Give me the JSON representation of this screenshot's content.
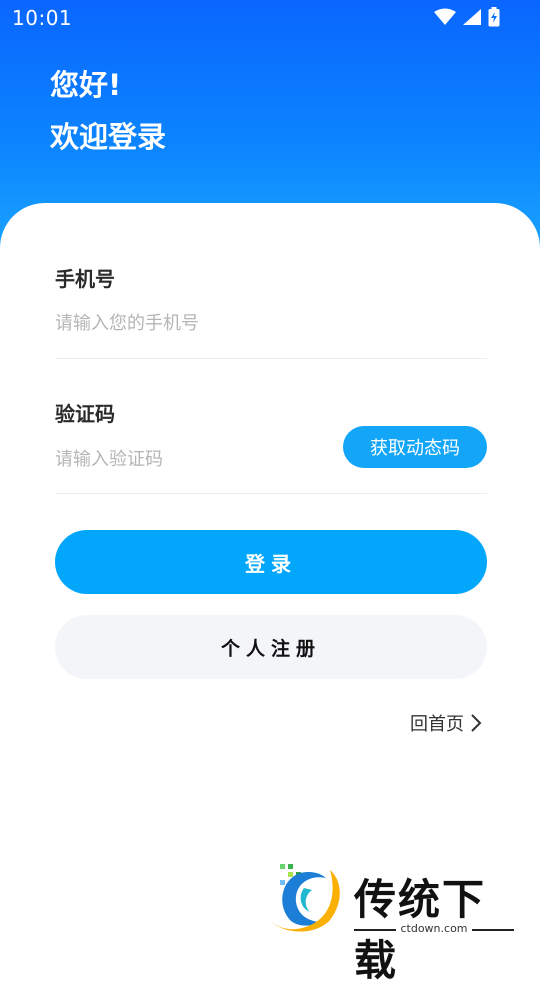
{
  "status_bar": {
    "time": "10:01",
    "icons": [
      "wifi-icon",
      "signal-icon",
      "battery-charging-icon"
    ]
  },
  "header": {
    "greeting_line1": "您好!",
    "greeting_line2": "欢迎登录"
  },
  "form": {
    "phone": {
      "label": "手机号",
      "value": "",
      "placeholder": "请输入您的手机号"
    },
    "code": {
      "label": "验证码",
      "value": "",
      "placeholder": "请输入验证码",
      "send_button_label": "获取动态码"
    }
  },
  "actions": {
    "login_label": "登录",
    "register_label": "个人注册",
    "home_link_label": "回首页",
    "home_link_icon": "chevron-right-icon"
  },
  "watermark": {
    "title": "传统下载",
    "url": "ctdown.com"
  },
  "colors": {
    "header_gradient_top": "#0a66ff",
    "header_gradient_bottom": "#1aa3ff",
    "primary_button": "#02a7fb",
    "code_button": "#13a5f8",
    "secondary_button": "#f4f5f9"
  }
}
